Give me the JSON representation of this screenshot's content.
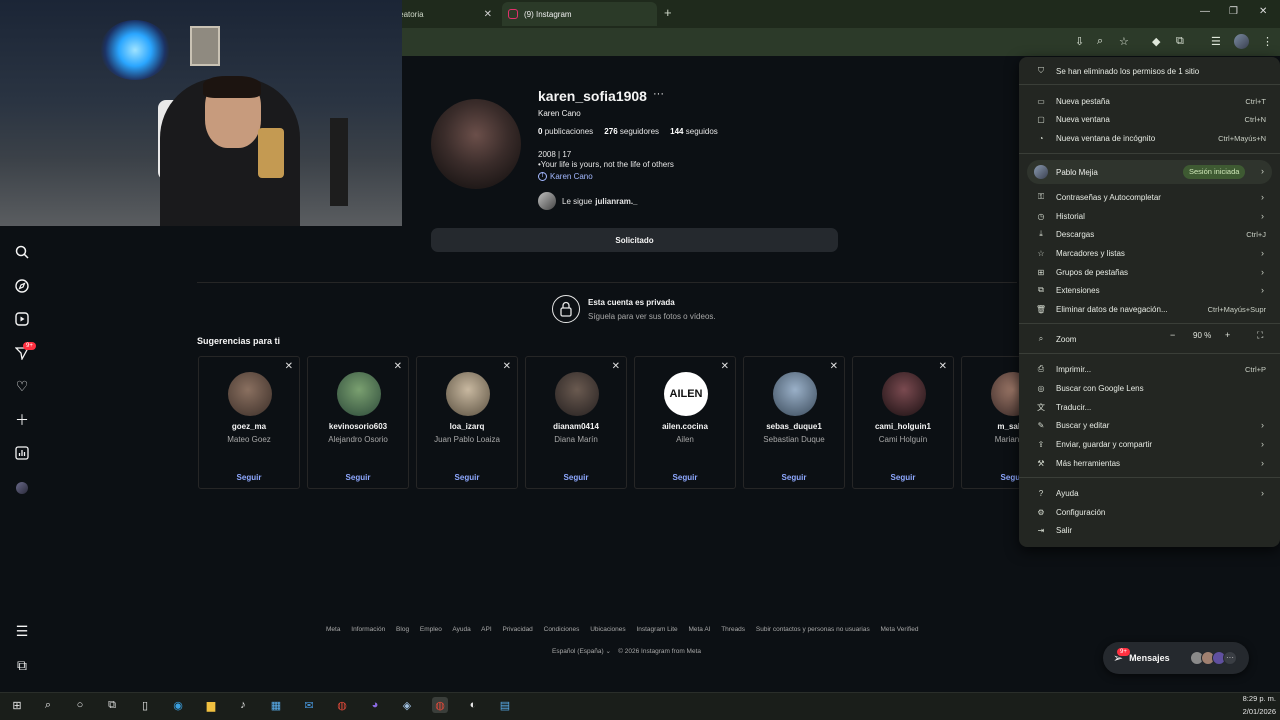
{
  "browser": {
    "tabs": [
      {
        "label": "Aleatoria"
      },
      {
        "label": "(9) Instagram"
      }
    ]
  },
  "profile": {
    "username": "karen_sofia1908",
    "full_name": "Karen Cano",
    "posts_count": "0",
    "posts_label": "publicaciones",
    "followers_count": "276",
    "followers_label": "seguidores",
    "following_count": "144",
    "following_label": "seguidos",
    "bio_line1": "2008 | 17",
    "bio_line2": "•Your life is yours, not the life of others",
    "facebook_link": "Karen Cano",
    "followed_by_prefix": "Le sigue",
    "followed_by_user": "julianram._",
    "request_button": "Solicitado",
    "private_title": "Esta cuenta es privada",
    "private_subtitle": "Síguela para ver sus fotos o vídeos."
  },
  "rail": {
    "notifications_badge": "9+"
  },
  "suggestions": {
    "title": "Sugerencias para ti",
    "follow_label": "Seguir",
    "cards": [
      {
        "user": "goez_ma",
        "name": "Mateo Goez"
      },
      {
        "user": "kevinosorio603",
        "name": "Alejandro Osorio"
      },
      {
        "user": "loa_izarq",
        "name": "Juan Pablo Loaiza"
      },
      {
        "user": "dianam0414",
        "name": "Diana Marín"
      },
      {
        "user": "ailen.cocina",
        "name": "Ailen"
      },
      {
        "user": "sebas_duque1",
        "name": "Sebastian Duque"
      },
      {
        "user": "cami_holguin1",
        "name": "Cami Holguín"
      },
      {
        "user": "m_salaz",
        "name": "Mariana S"
      }
    ]
  },
  "footer": {
    "links": [
      "Meta",
      "Información",
      "Blog",
      "Empleo",
      "Ayuda",
      "API",
      "Privacidad",
      "Condiciones",
      "Ubicaciones",
      "Instagram Lite",
      "Meta AI",
      "Threads",
      "Subir contactos y personas no usuarias",
      "Meta Verified"
    ],
    "language": "Español (España)",
    "copyright": "© 2026 Instagram from Meta"
  },
  "messages": {
    "label": "Mensajes",
    "badge": "9+"
  },
  "chrome_menu": {
    "permission_notice": "Se han eliminado los permisos de 1 sitio",
    "new_tab": "Nueva pestaña",
    "new_tab_short": "Ctrl+T",
    "new_window": "Nueva ventana",
    "new_window_short": "Ctrl+N",
    "incognito": "Nueva ventana de incógnito",
    "incognito_short": "Ctrl+Mayús+N",
    "profile_name": "Pablo Mejia",
    "profile_status": "Sesión iniciada",
    "passwords": "Contraseñas y Autocompletar",
    "history": "Historial",
    "downloads": "Descargas",
    "downloads_short": "Ctrl+J",
    "bookmarks": "Marcadores y listas",
    "tab_groups": "Grupos de pestañas",
    "extensions": "Extensiones",
    "clear_data": "Eliminar datos de navegación...",
    "clear_data_short": "Ctrl+Mayús+Supr",
    "zoom_label": "Zoom",
    "zoom_value": "90 %",
    "print": "Imprimir...",
    "print_short": "Ctrl+P",
    "lens": "Buscar con Google Lens",
    "translate": "Traducir...",
    "find_edit": "Buscar y editar",
    "send_save": "Enviar, guardar y compartir",
    "more_tools": "Más herramientas",
    "help": "Ayuda",
    "settings": "Configuración",
    "exit": "Salir"
  },
  "taskbar": {
    "time": "8:29 p. m.",
    "date": "2/01/2026"
  },
  "colors": {
    "ig_background": "#0c1014",
    "link_blue": "#8ea8ff",
    "badge_red": "#ff3040",
    "menu_bg": "#232622",
    "signed_in_green": "#3e5a32"
  }
}
